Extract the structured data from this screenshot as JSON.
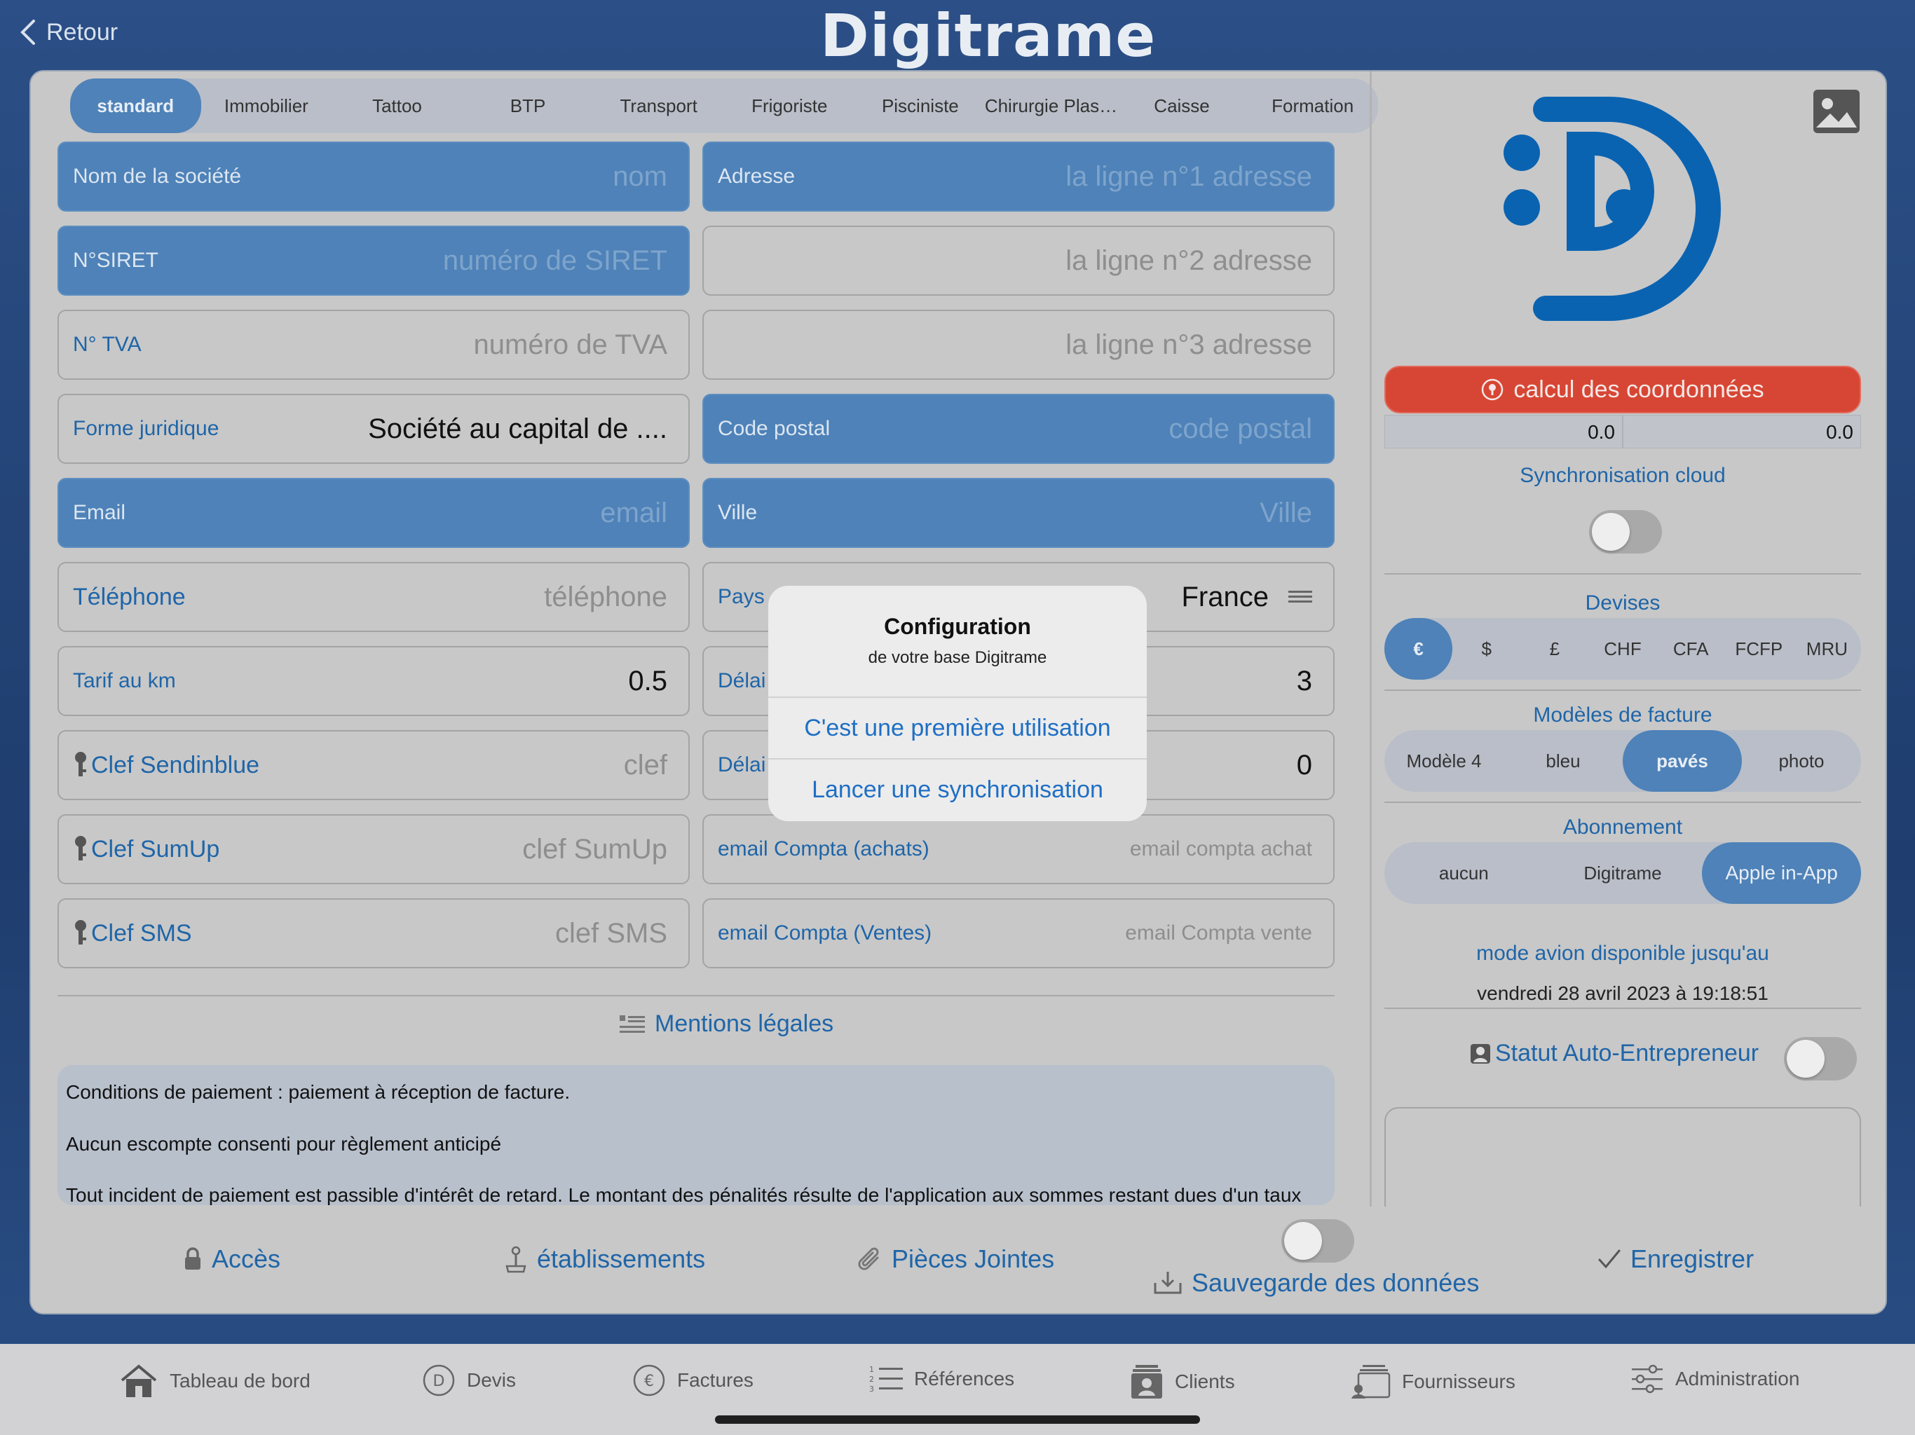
{
  "header": {
    "back_label": "Retour",
    "brand": "Digitrame"
  },
  "categories": {
    "items": [
      "standard",
      "Immobilier",
      "Tattoo",
      "BTP",
      "Transport",
      "Frigoriste",
      "Pisciniste",
      "Chirurgie Plas…",
      "Caisse",
      "Formation"
    ],
    "active": "standard"
  },
  "form": {
    "company_name": {
      "label": "Nom de la société",
      "placeholder": "nom"
    },
    "siret": {
      "label": "N°SIRET",
      "placeholder": "numéro de SIRET"
    },
    "tva": {
      "label": "N° TVA",
      "placeholder": "numéro de TVA"
    },
    "legal_form": {
      "label": "Forme juridique",
      "value": "Société au capital de ...."
    },
    "email": {
      "label": "Email",
      "placeholder": "email"
    },
    "phone": {
      "label": "Téléphone",
      "placeholder": "téléphone"
    },
    "rate_km": {
      "label": "Tarif au km",
      "value": "0.5"
    },
    "sendinblue": {
      "label": "Clef Sendinblue",
      "placeholder": "clef"
    },
    "sumup": {
      "label": "Clef SumUp",
      "placeholder": "clef SumUp"
    },
    "sms": {
      "label": "Clef SMS",
      "placeholder": "clef SMS"
    },
    "address1": {
      "label": "Adresse",
      "placeholder": "la ligne n°1 adresse"
    },
    "address2": {
      "placeholder": "la ligne n°2 adresse"
    },
    "address3": {
      "placeholder": "la ligne n°3 adresse"
    },
    "postal_code": {
      "label": "Code postal",
      "placeholder": "code postal"
    },
    "city": {
      "label": "Ville",
      "placeholder": "Ville"
    },
    "country": {
      "label": "Pays",
      "value": "France"
    },
    "delay1": {
      "label": "Délai",
      "value": "3"
    },
    "delay2": {
      "label": "Délai",
      "value": "0"
    },
    "email_purchases": {
      "label": "email Compta (achats)",
      "placeholder": "email compta achat"
    },
    "email_sales": {
      "label": "email Compta (Ventes)",
      "placeholder": "email Compta vente"
    }
  },
  "mentions": {
    "title": "Mentions légales",
    "lines": [
      "Conditions de paiement : paiement à réception de facture.",
      "Aucun escompte consenti pour règlement anticipé",
      "Tout incident de paiement est passible d'intérêt de retard. Le montant des pénalités résulte de l'application aux sommes restant dues d'un taux d'intérêt légal en vigueur au moment de l'incident."
    ]
  },
  "actions": {
    "acces": "Accès",
    "etablissements": "établissements",
    "pieces": "Pièces Jointes",
    "sauvegarde": "Sauvegarde des données",
    "enregistrer": "Enregistrer"
  },
  "right": {
    "calc_button": "calcul des coordonnées",
    "coord_lat": "0.0",
    "coord_lon": "0.0",
    "sync_title": "Synchronisation cloud",
    "sync_on": false,
    "devises_title": "Devises",
    "devises": [
      "€",
      "$",
      "£",
      "CHF",
      "CFA",
      "FCFP",
      "MRU"
    ],
    "devise_active": "€",
    "modeles_title": "Modèles de facture",
    "modeles": [
      "Modèle 4",
      "bleu",
      "pavés",
      "photo"
    ],
    "modele_active": "pavés",
    "abonnement_title": "Abonnement",
    "abonnements": [
      "aucun",
      "Digitrame",
      "Apple in-App"
    ],
    "abonnement_active": "Apple in-App",
    "avion_title": "mode avion disponible jusqu'au",
    "avion_date": "vendredi 28 avril 2023 à 19:18:51",
    "statut_label": "Statut Auto-Entrepreneur",
    "statut_on": false
  },
  "modal": {
    "title": "Configuration",
    "subtitle": "de votre base Digitrame",
    "option1": "C'est une première utilisation",
    "option2": "Lancer une synchronisation"
  },
  "tabbar": [
    "Tableau de bord",
    "Devis",
    "Factures",
    "Références",
    "Clients",
    "Fournisseurs",
    "Administration"
  ],
  "colors": {
    "accent_blue": "#4e82b8",
    "link_blue": "#1f65a8",
    "danger": "#d74634"
  }
}
